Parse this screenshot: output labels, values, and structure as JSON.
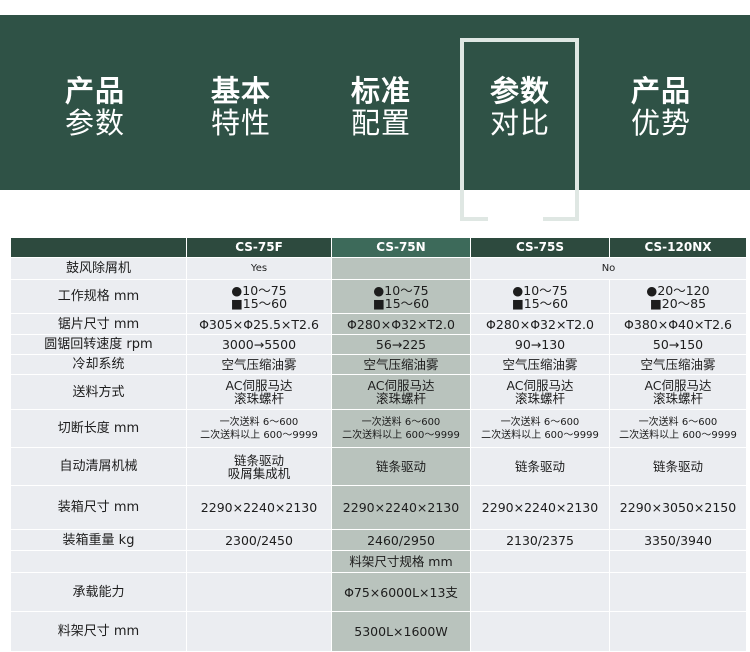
{
  "nav": {
    "tabs": [
      {
        "line1": "产品",
        "line2": "参数"
      },
      {
        "line1": "基本",
        "line2": "特性"
      },
      {
        "line1": "标准",
        "line2": "配置"
      },
      {
        "line1": "参数",
        "line2": "对比"
      },
      {
        "line1": "产品",
        "line2": "优势"
      }
    ],
    "active_index": 3
  },
  "table": {
    "columns": [
      "CS-75F",
      "CS-75N",
      "CS-75S",
      "CS-120NX"
    ],
    "rows": {
      "blower": {
        "label": "鼓风除屑机",
        "f": "Yes",
        "sx": "No"
      },
      "range": {
        "label": "工作规格 mm",
        "f1": "●10～75",
        "f2": "■15～60",
        "n1": "●10～75",
        "n2": "■15～60",
        "s1": "●10～75",
        "s2": "■15～60",
        "x1": "●20～120",
        "x2": "■20～85"
      },
      "blade": {
        "label": "锯片尺寸 mm",
        "f": "Φ305×Φ25.5×T2.6",
        "n": "Φ280×Φ32×T2.0",
        "s": "Φ280×Φ32×T2.0",
        "x": "Φ380×Φ40×T2.6"
      },
      "speed": {
        "label": "圆锯回转速度 rpm",
        "f": "3000→5500",
        "n": "56→225",
        "s": "90→130",
        "x": "50→150"
      },
      "cooling": {
        "label": "冷却系统",
        "f": "空气压缩油雾",
        "n": "空气压缩油雾",
        "s": "空气压缩油雾",
        "x": "空气压缩油雾"
      },
      "feed": {
        "label": "送料方式",
        "l1": "AC伺服马达",
        "l2": "滚珠螺杆"
      },
      "cut": {
        "label": "切断长度 mm",
        "f1": "一次送料 6～600",
        "f2": "二次送料以上 600～9999",
        "n1": "一次送料 6～600",
        "n2": "二次送料以上 600～9999",
        "s1": "一次送料 6～600",
        "s2": "二次送料以上 600～9999",
        "x1": "一次送料 6～600",
        "x2": "二次送料以上 600～9999"
      },
      "chip": {
        "label": "自动清屑机械",
        "f1": "链条驱动",
        "f2": "吸屑集成机",
        "n": "链条驱动",
        "s": "链条驱动",
        "x": "链条驱动"
      },
      "box": {
        "label": "装箱尺寸 mm",
        "f": "2290×2240×2130",
        "n": "2290×2240×2130",
        "s": "2290×2240×2130",
        "x": "2290×3050×2150"
      },
      "weight": {
        "label": "装箱重量 kg",
        "f": "2300/2450",
        "n": "2460/2950",
        "s": "2130/2375",
        "x": "3350/3940"
      },
      "rack_header": {
        "n": "料架尺寸规格 mm"
      },
      "load": {
        "label": "承载能力",
        "n": "Φ75×6000L×13支"
      },
      "rack": {
        "label": "料架尺寸 mm",
        "n": "5300L×1600W"
      }
    }
  }
}
